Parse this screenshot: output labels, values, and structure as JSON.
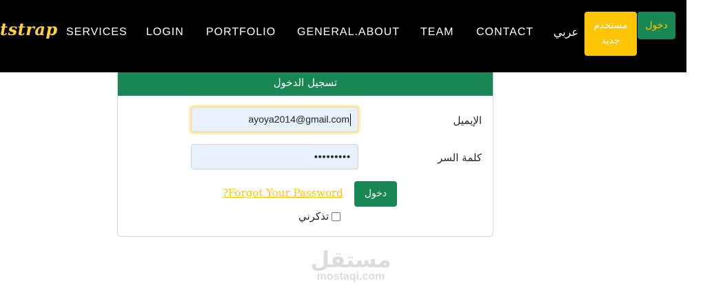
{
  "navbar": {
    "brand": "tstrap",
    "links": [
      "SERVICES",
      "LOGIN",
      "PORTFOLIO",
      "GENERAL.ABOUT",
      "TEAM",
      "CONTACT"
    ],
    "language": "عربي",
    "register_line1": "مستخدم",
    "register_line2": "جديد",
    "login_button": "دخول"
  },
  "login_card": {
    "header": "تسجيل الدخول",
    "email_label": "الإيميل",
    "email_value": "ayoya2014@gmail.com",
    "password_label": "كلمة السر",
    "password_value": "•••••••••",
    "submit_label": "دخول",
    "forgot_link": "?Forgot Your Password",
    "remember_label": "تذكرني"
  },
  "watermark": {
    "arabic": "مستقل",
    "latin": "mostaqi.com"
  },
  "colors": {
    "navbar_bg": "#000000",
    "accent_yellow": "#fec503",
    "primary_green": "#198754",
    "input_autofill_bg": "#e8f0fe"
  }
}
